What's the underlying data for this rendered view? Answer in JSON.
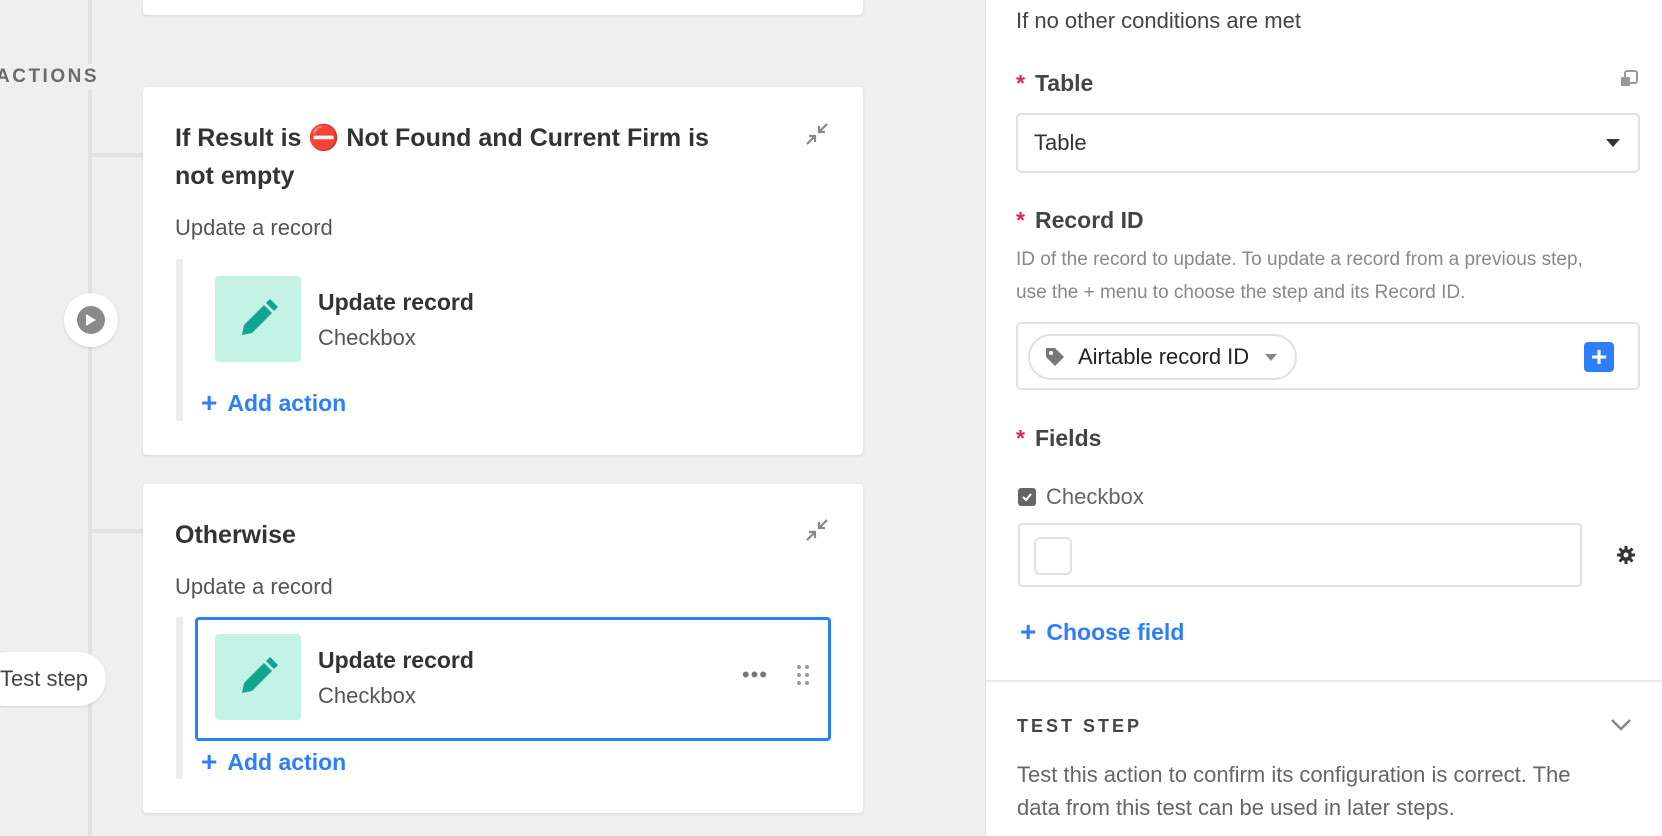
{
  "canvas": {
    "section_label": "ACTIONS",
    "test_step_label": "Test step",
    "cards": [
      {
        "title": "If Result is ⛔ Not Found and Current Firm is not empty",
        "subtitle": "Update a record",
        "action": {
          "title": "Update record",
          "subtitle": "Checkbox",
          "icon": "pencil-icon"
        },
        "add_action": "Add action"
      },
      {
        "title": "Otherwise",
        "subtitle": "Update a record",
        "action": {
          "title": "Update record",
          "subtitle": "Checkbox",
          "icon": "pencil-icon",
          "selected": true
        },
        "add_action": "Add action"
      }
    ]
  },
  "panel": {
    "condition_text": "If no other conditions are met",
    "table": {
      "label": "Table",
      "value": "Table"
    },
    "record_id": {
      "label": "Record ID",
      "help": "ID of the record to update. To update a record from a previous step, use the + menu to choose the step and its Record ID.",
      "token": "Airtable record ID"
    },
    "fields": {
      "label": "Fields",
      "items": [
        {
          "name": "Checkbox",
          "checked": false
        }
      ],
      "choose_field": "Choose field"
    },
    "test_step": {
      "label": "TEST STEP",
      "description": "Test this action to confirm its configuration is correct. The data from this test can be used in later steps."
    }
  },
  "colors": {
    "accent": "#2d7ff9",
    "tile_bg": "#c4f3e6",
    "icon_teal": "#0fa58e",
    "required": "#e0245e"
  }
}
